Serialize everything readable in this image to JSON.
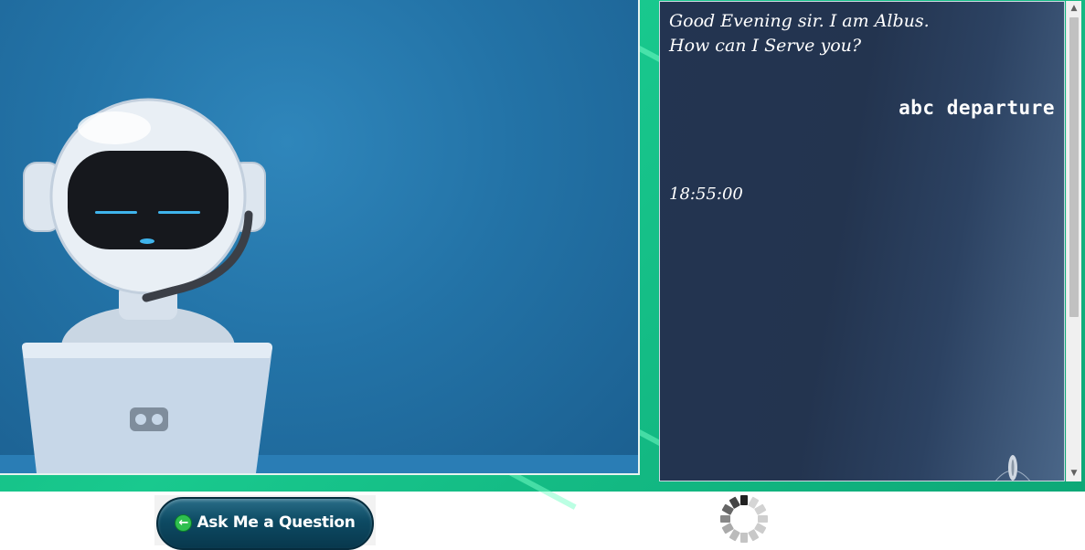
{
  "chat": {
    "greeting_line1": "Good Evening sir. I am Albus.",
    "greeting_line2": "How can I Serve you?",
    "user_message": "abc departure",
    "bot_reply": "18:55:00"
  },
  "controls": {
    "ask_button_label": "Ask Me a Question",
    "ask_button_icon": "arrow-left-icon"
  },
  "icons": {
    "scroll_up": "▲",
    "scroll_down": "▼",
    "ask_arrow": "←"
  },
  "colors": {
    "accent_green": "#19c98e",
    "scene_blue": "#2373a7",
    "chat_bg": "#233451",
    "button_dark": "#0d4a63"
  }
}
